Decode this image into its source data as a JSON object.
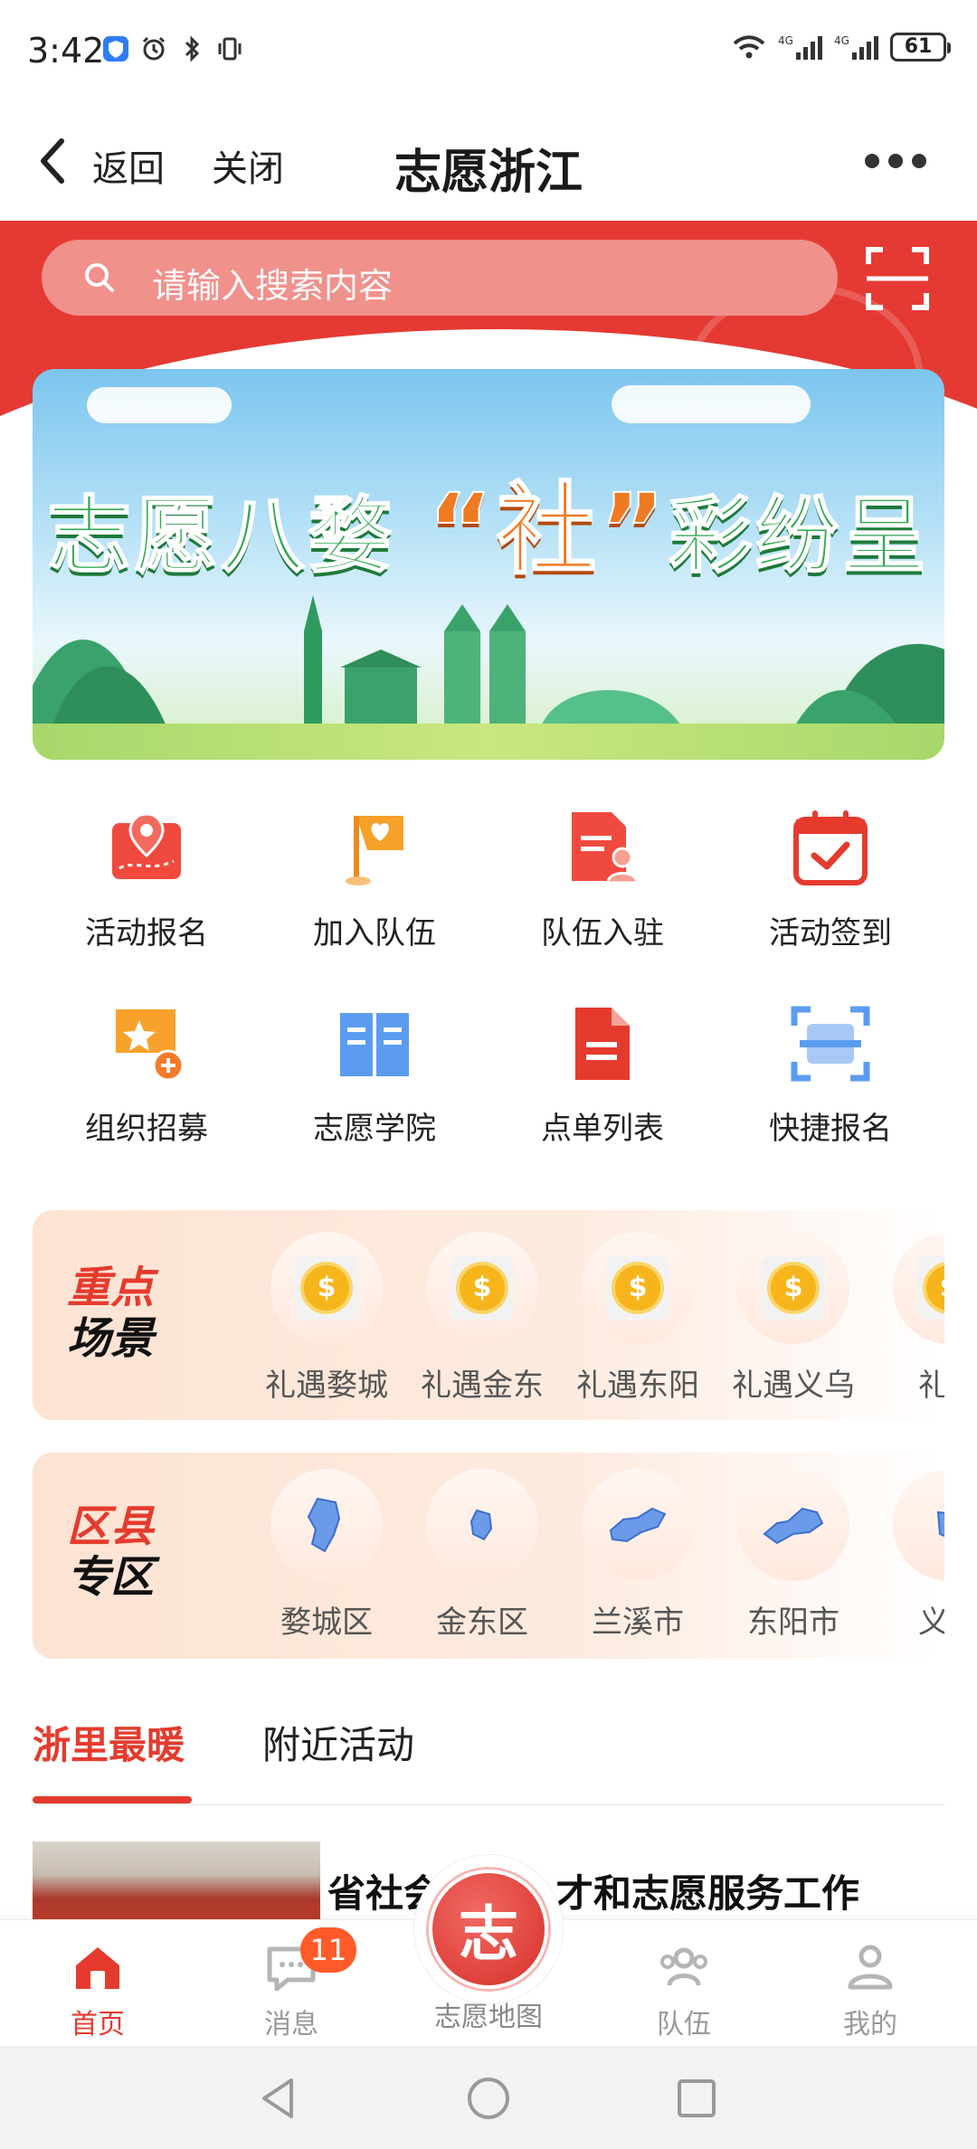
{
  "status_bar": {
    "time": "3:42",
    "battery": "61",
    "net1": "4G",
    "net2": "4G"
  },
  "header": {
    "back_label": "返回",
    "close_label": "关闭",
    "title": "志愿浙江"
  },
  "search": {
    "placeholder": "请输入搜索内容"
  },
  "banner": {
    "title_left": "志愿八婺",
    "title_mid": "“社”",
    "title_right": "彩纷呈"
  },
  "grid": [
    {
      "label": "活动报名",
      "icon": "map-pin-icon"
    },
    {
      "label": "加入队伍",
      "icon": "heart-flag-icon"
    },
    {
      "label": "队伍入驻",
      "icon": "document-user-icon"
    },
    {
      "label": "活动签到",
      "icon": "calendar-check-icon"
    },
    {
      "label": "组织招募",
      "icon": "star-flag-icon"
    },
    {
      "label": "志愿学院",
      "icon": "book-icon"
    },
    {
      "label": "点单列表",
      "icon": "list-document-icon"
    },
    {
      "label": "快捷报名",
      "icon": "scan-document-icon"
    }
  ],
  "scenes": {
    "title_l1": "重点",
    "title_l2": "场景",
    "items": [
      "礼遇婺城",
      "礼遇金东",
      "礼遇东阳",
      "礼遇义乌",
      "礼遇"
    ]
  },
  "districts": {
    "title_l1": "区县",
    "title_l2": "专区",
    "items": [
      "婺城区",
      "金东区",
      "兰溪市",
      "东阳市",
      "义乌"
    ]
  },
  "tabs": {
    "active": "浙里最暖",
    "other": "附近活动"
  },
  "news": {
    "title": "省社会工作人才和志愿服务工作"
  },
  "bottom_nav": {
    "home": "首页",
    "messages": "消息",
    "messages_badge": "11",
    "map": "志愿地图",
    "center_char": "志",
    "team": "队伍",
    "mine": "我的"
  },
  "colors": {
    "brand_red": "#e43b2e",
    "badge": "#ff5a2a"
  }
}
